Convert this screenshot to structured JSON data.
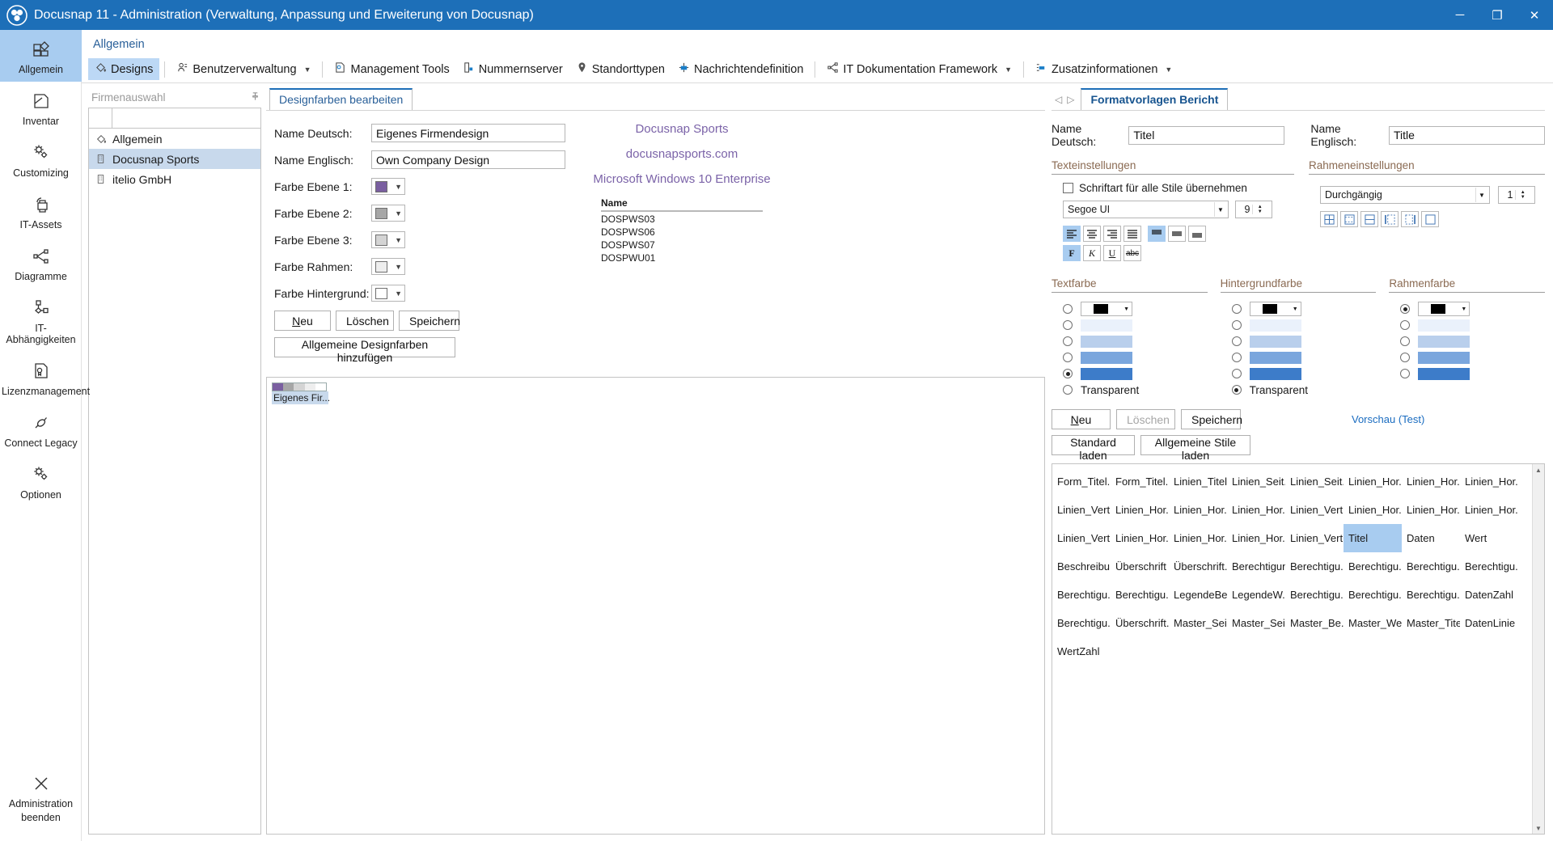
{
  "window": {
    "title": "Docusnap 11 - Administration (Verwaltung, Anpassung und Erweiterung von Docusnap)",
    "minimize": "─",
    "maximize": "❐",
    "close": "✕"
  },
  "sidebar": {
    "items": [
      {
        "label": "Allgemein",
        "icon": "layout-blocks-icon",
        "active": true
      },
      {
        "label": "Inventar",
        "icon": "document-folded-icon",
        "active": false
      },
      {
        "label": "Customizing",
        "icon": "gears-icon",
        "active": false
      },
      {
        "label": "IT-Assets",
        "icon": "printer-icon",
        "active": false
      },
      {
        "label": "Diagramme",
        "icon": "share-nodes-icon",
        "active": false
      },
      {
        "label": "IT-Abhängigkeiten",
        "icon": "dependency-nodes-icon",
        "active": false
      },
      {
        "label": "Lizenzmanagement",
        "icon": "certificate-icon",
        "active": false
      },
      {
        "label": "Connect Legacy",
        "icon": "connector-icon",
        "active": false
      },
      {
        "label": "Optionen",
        "icon": "gears-icon",
        "active": false
      }
    ],
    "exit": {
      "line1": "Administration",
      "line2": "beenden",
      "icon": "close-x-icon"
    }
  },
  "breadcrumb": "Allgemein",
  "ribbon": {
    "items": [
      {
        "label": "Designs",
        "icon": "paint-bucket-icon",
        "active": true,
        "dropdown": false
      },
      {
        "label": "Benutzerverwaltung",
        "icon": "user-icon",
        "active": false,
        "dropdown": true
      },
      {
        "label": "Management Tools",
        "icon": "tools-icon",
        "active": false,
        "dropdown": false
      },
      {
        "label": "Nummernserver",
        "icon": "number-icon",
        "active": false,
        "dropdown": false
      },
      {
        "label": "Standorttypen",
        "icon": "location-pin-icon",
        "active": false,
        "dropdown": false
      },
      {
        "label": "Nachrichtendefinition",
        "icon": "message-icon",
        "active": false,
        "dropdown": false
      },
      {
        "label": "IT Dokumentation Framework",
        "icon": "framework-icon",
        "active": false,
        "dropdown": true
      },
      {
        "label": "Zusatzinformationen",
        "icon": "extra-info-icon",
        "active": false,
        "dropdown": true
      }
    ]
  },
  "company_panel": {
    "title": "Firmenauswahl",
    "pin_icon": "pin-icon",
    "rows": [
      {
        "label": "Allgemein",
        "icon": "paint-bucket-icon",
        "selected": false
      },
      {
        "label": "Docusnap Sports",
        "icon": "building-icon",
        "selected": true
      },
      {
        "label": "itelio GmbH",
        "icon": "building-icon",
        "selected": false
      }
    ]
  },
  "design_panel": {
    "tab": "Designfarben bearbeiten",
    "nav_prev": "◁",
    "nav_next": "▷",
    "fields": [
      {
        "label": "Name Deutsch:",
        "value": "Eigenes Firmendesign"
      },
      {
        "label": "Name Englisch:",
        "value": "Own Company Design"
      }
    ],
    "colors": [
      {
        "label": "Farbe Ebene 1:",
        "hex": "#7a5fa0"
      },
      {
        "label": "Farbe Ebene 2:",
        "hex": "#a6a6a6"
      },
      {
        "label": "Farbe Ebene 3:",
        "hex": "#d4d4d4"
      },
      {
        "label": "Farbe Rahmen:",
        "hex": "#eeeeee"
      },
      {
        "label": "Farbe Hintergrund:",
        "hex": "#ffffff"
      }
    ],
    "buttons": {
      "new": "Neu",
      "delete": "Löschen",
      "save": "Speichern",
      "add_general": "Allgemeine Designfarben hinzufügen"
    },
    "preview": {
      "line1": "Docusnap Sports",
      "line2": "docusnapsports.com",
      "line3": "Microsoft Windows 10 Enterprise",
      "table_header": "Name",
      "table_rows": [
        "DOSPWS03",
        "DOSPWS06",
        "DOSPWS07",
        "DOSPWU01"
      ]
    },
    "design_card": {
      "name": "Eigenes Fir...",
      "swatches": [
        "#7a5fa0",
        "#a6a6a6",
        "#d4d4d4",
        "#eeeeee",
        "#ffffff"
      ]
    }
  },
  "report_panel": {
    "tab": "Formatvorlagen Bericht",
    "nav_prev": "◁",
    "nav_next": "▷",
    "name_de_label": "Name Deutsch:",
    "name_de_value": "Titel",
    "name_en_label": "Name Englisch:",
    "name_en_value": "Title",
    "text_settings": {
      "title": "Texteinstellungen",
      "checkbox_label": "Schriftart für alle Stile übernehmen",
      "checkbox_checked": false,
      "font_family": "Segoe UI",
      "font_size": "9",
      "align_buttons": [
        {
          "icon": "align-left-icon",
          "active": true
        },
        {
          "icon": "align-center-icon",
          "active": false
        },
        {
          "icon": "align-right-icon",
          "active": false
        },
        {
          "icon": "align-justify-icon",
          "active": false
        },
        {
          "icon": "valign-top-icon",
          "active": true
        },
        {
          "icon": "valign-middle-icon",
          "active": false
        },
        {
          "icon": "valign-bottom-icon",
          "active": false
        }
      ],
      "style_buttons": [
        {
          "label": "F",
          "name": "bold-button",
          "active": true
        },
        {
          "label": "K",
          "name": "italic-button",
          "active": false
        },
        {
          "label": "U",
          "name": "underline-button",
          "active": false
        },
        {
          "label": "abc",
          "name": "strikethrough-button",
          "active": false
        }
      ]
    },
    "frame_settings": {
      "title": "Rahmeneinstellungen",
      "line_style": "Durchgängig",
      "line_width": "1",
      "border_buttons": [
        "border-all-icon",
        "border-outer-icon",
        "border-box-icon",
        "border-left-icon",
        "border-right-icon",
        "border-none-icon"
      ]
    },
    "color_groups": [
      {
        "title": "Textfarbe",
        "selected_index": 5,
        "swatches": [
          "#000000",
          "#eaf1fb",
          "#b9cfec",
          "#7aa6dd",
          "#3d7cc9",
          "transparent"
        ],
        "transparent_label": "Transparent"
      },
      {
        "title": "Hintergrundfarbe",
        "selected_index": 5,
        "swatches": [
          "#000000",
          "#eaf1fb",
          "#b9cfec",
          "#7aa6dd",
          "#3d7cc9",
          "transparent"
        ],
        "transparent_label": "Transparent"
      },
      {
        "title": "Rahmenfarbe",
        "selected_index": 0,
        "swatches": [
          "#000000",
          "#eaf1fb",
          "#b9cfec",
          "#7aa6dd",
          "#3d7cc9"
        ],
        "transparent_label": ""
      }
    ],
    "buttons": {
      "new": "Neu",
      "delete": "Löschen",
      "save": "Speichern",
      "load_standard": "Standard laden",
      "load_general": "Allgemeine Stile laden",
      "preview_link": "Vorschau (Test)"
    },
    "styles_grid": {
      "selected_cell": "Titel",
      "rows": [
        [
          "Form_Titel...",
          "Form_Titel...",
          "Linien_Titel...",
          "Linien_Seit...",
          "Linien_Seit...",
          "Linien_Hor...",
          "Linien_Hor...",
          "Linien_Hor..."
        ],
        [
          "Linien_Vert...",
          "Linien_Hor...",
          "Linien_Hor...",
          "Linien_Hor...",
          "Linien_Vert...",
          "Linien_Hor...",
          "Linien_Hor...",
          "Linien_Hor..."
        ],
        [
          "Linien_Vert...",
          "Linien_Hor...",
          "Linien_Hor...",
          "Linien_Hor...",
          "Linien_Vert...",
          "Titel",
          "Daten",
          "Wert"
        ],
        [
          "Beschreibu...",
          "Überschrift",
          "Überschrift...",
          "Berechtigun...",
          "Berechtigu...",
          "Berechtigu...",
          "Berechtigu...",
          "Berechtigu..."
        ],
        [
          "Berechtigu...",
          "Berechtigu...",
          "LegendeBe...",
          "LegendeW...",
          "Berechtigu...",
          "Berechtigu...",
          "Berechtigu...",
          "DatenZahl"
        ],
        [
          "Berechtigu...",
          "Überschrift...",
          "Master_Sei...",
          "Master_Sei...",
          "Master_Be...",
          "Master_Wert",
          "Master_Titel",
          "DatenLinie"
        ],
        [
          "WertZahl",
          "",
          "",
          "",
          "",
          "",
          "",
          ""
        ]
      ]
    }
  },
  "colors": {
    "titlebar": "#1d6fb8",
    "accent": "#a8ccf0",
    "link": "#2a6099",
    "selection": "#c8d9ec"
  }
}
